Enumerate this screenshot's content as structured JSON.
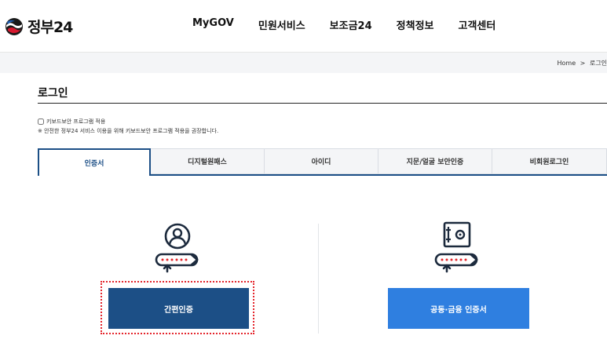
{
  "header": {
    "logo_text": "정부24",
    "nav": [
      "MyGOV",
      "민원서비스",
      "보조금24",
      "정책정보",
      "고객센터"
    ]
  },
  "breadcrumb": {
    "home": "Home",
    "separator": ">",
    "current": "로그인"
  },
  "page_title": "로그인",
  "keyboard_security": {
    "label": "키보드보안 프로그램 적용",
    "checked": false,
    "notice": "※ 안전한 정부24 서비스 이용을 위해 키보드보안 프로그램 적용을 권장합니다."
  },
  "tabs": [
    "인증서",
    "디지털원패스",
    "아이디",
    "지문/얼굴 보안인증",
    "비회원로그인"
  ],
  "active_tab": "인증서",
  "login_methods": {
    "simple": {
      "label": "간편인증",
      "icon": "user-key-icon"
    },
    "certificate": {
      "label": "공동·금융 인증서",
      "icon": "certificate-key-icon"
    }
  },
  "colors": {
    "primary_navy": "#1c4f86",
    "primary_blue": "#2f7fe0",
    "focus_outline": "#e4252c"
  }
}
